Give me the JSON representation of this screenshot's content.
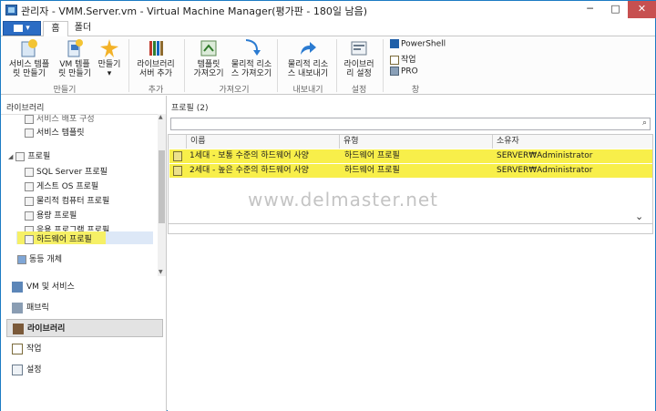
{
  "window": {
    "title": "관리자 - VMM.Server.vm - Virtual Machine Manager(평가판 - 180일 남음)",
    "minimize": "─",
    "maximize": "□",
    "close": "✕"
  },
  "ribbon_tabs": {
    "file": "▾",
    "home": "홈",
    "folder": "폴더"
  },
  "ribbon": {
    "create_service_template_l1": "서비스 템플",
    "create_service_template_l2": "릿 만들기",
    "create_vm_template_l1": "VM 템플",
    "create_vm_template_l2": "릿 만들기",
    "create_l1": "만들기",
    "create_l2": "▾",
    "group_create": "만들기",
    "add_library_server_l1": "라이브러리",
    "add_library_server_l2": "서버 추가",
    "group_add": "추가",
    "import_template_l1": "템플릿",
    "import_template_l2": "가져오기",
    "import_physical_l1": "물리적 리소",
    "import_physical_l2": "스 가져오기",
    "group_import": "가져오기",
    "export_physical_l1": "물리적 리소",
    "export_physical_l2": "스 내보내기",
    "group_export": "내보내기",
    "library_settings_l1": "라이브러",
    "library_settings_l2": "리 설정",
    "group_settings": "설정",
    "powershell": "PowerShell",
    "jobs": "작업",
    "pro": "PRO",
    "group_window": "창"
  },
  "left": {
    "header": "라이브러리",
    "tree": {
      "partial_top": "서비스 배포 구성",
      "service_templates": "서비스 템플릿",
      "profiles": "프로필",
      "sql_server_profile": "SQL Server 프로필",
      "guest_os_profile": "게스트 OS 프로필",
      "physical_computer_profile": "물리적 컴퓨터 프로필",
      "capacity_profile": "용량 프로필",
      "application_profile": "응용 프로그램 프로필",
      "hardware_profile": "하드웨어 프로필",
      "equivalent_objects": "동등 개체"
    },
    "nav": {
      "vms_services": "VM 및 서비스",
      "fabric": "패브릭",
      "library": "라이브러리",
      "jobs": "작업",
      "settings": "설정"
    }
  },
  "right": {
    "header": "프로필 (2)",
    "search_icon": "⌕",
    "columns": {
      "name": "이름",
      "type": "유형",
      "owner": "소유자"
    },
    "rows": [
      {
        "name": "1세대 - 보통 수준의 하드웨어 사양",
        "type": "하드웨어 프로필",
        "owner": "SERVER₩Administrator"
      },
      {
        "name": "2세대 - 높은 수준의 하드웨어 사양",
        "type": "하드웨어 프로필",
        "owner": "SERVER₩Administrator"
      }
    ],
    "watermark": "www.delmaster.net",
    "chevron": "⌄"
  }
}
